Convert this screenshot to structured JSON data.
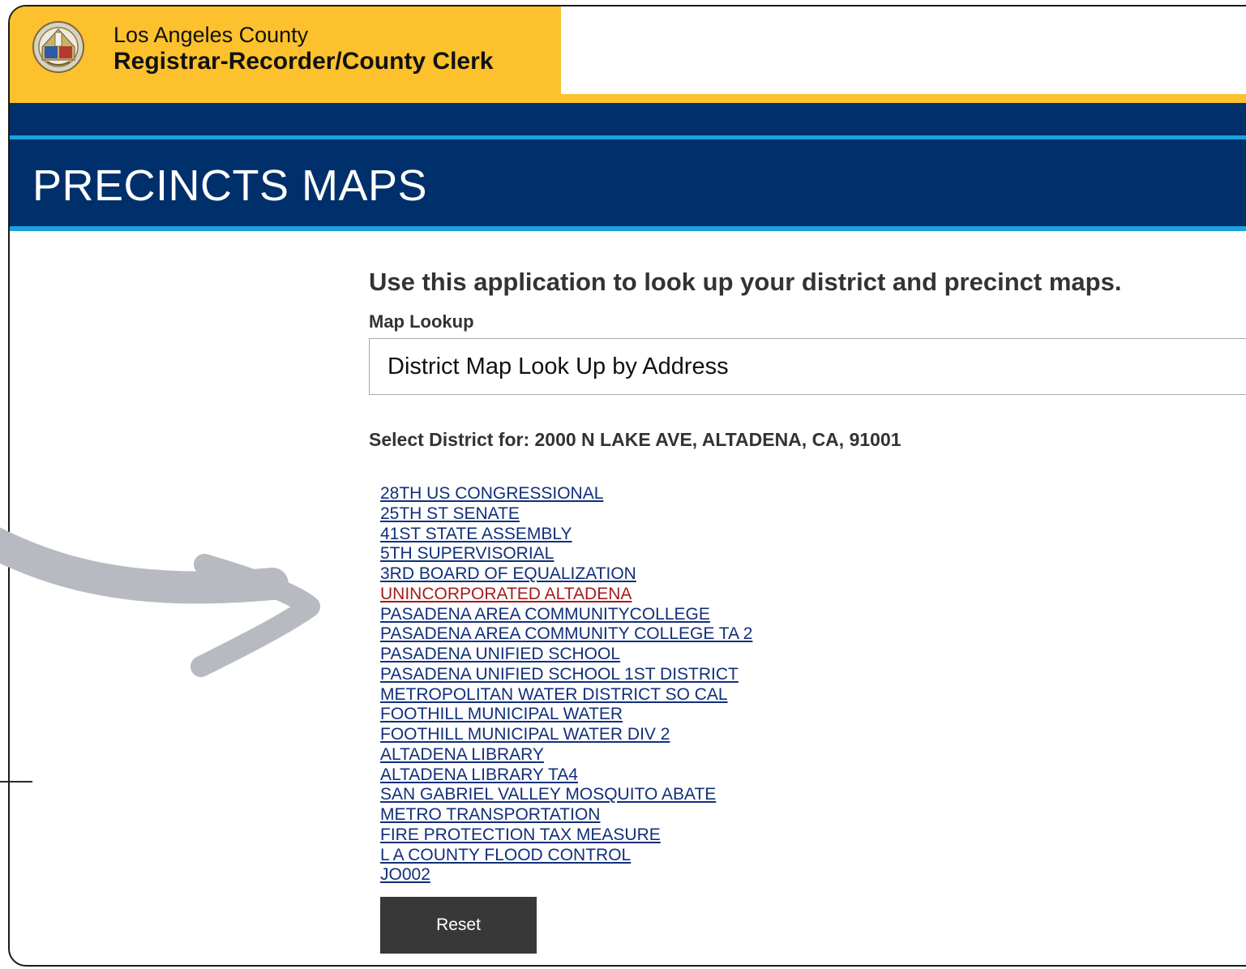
{
  "header": {
    "agency_line1": "Los Angeles County",
    "agency_line2": "Registrar-Recorder/County Clerk",
    "seal_icon": "county-seal-icon"
  },
  "page": {
    "title": "PRECINCTS MAPS"
  },
  "content": {
    "intro": "Use this application to look up your district and precinct maps.",
    "lookup_label": "Map Lookup",
    "lookup_value": "District Map Look Up by Address",
    "select_for": "Select District for: 2000 N LAKE AVE, ALTADENA, CA, 91001"
  },
  "districts": [
    {
      "label": "28TH US CONGRESSIONAL",
      "active": false
    },
    {
      "label": "25TH ST SENATE",
      "active": false
    },
    {
      "label": "41ST STATE ASSEMBLY",
      "active": false
    },
    {
      "label": "5TH SUPERVISORIAL",
      "active": false
    },
    {
      "label": "3RD BOARD OF EQUALIZATION",
      "active": false
    },
    {
      "label": "UNINCORPORATED ALTADENA",
      "active": true
    },
    {
      "label": "PASADENA AREA COMMUNITYCOLLEGE",
      "active": false
    },
    {
      "label": "PASADENA AREA COMMUNITY COLLEGE TA 2",
      "active": false
    },
    {
      "label": "PASADENA UNIFIED SCHOOL",
      "active": false
    },
    {
      "label": "PASADENA UNIFIED SCHOOL 1ST DISTRICT",
      "active": false
    },
    {
      "label": "METROPOLITAN WATER DISTRICT SO CAL",
      "active": false
    },
    {
      "label": "FOOTHILL MUNICIPAL WATER",
      "active": false
    },
    {
      "label": "FOOTHILL MUNICIPAL WATER DIV 2",
      "active": false
    },
    {
      "label": "ALTADENA LIBRARY",
      "active": false
    },
    {
      "label": "ALTADENA LIBRARY TA4",
      "active": false
    },
    {
      "label": "SAN GABRIEL VALLEY MOSQUITO ABATE",
      "active": false
    },
    {
      "label": "METRO TRANSPORTATION",
      "active": false
    },
    {
      "label": "FIRE PROTECTION TAX MEASURE",
      "active": false
    },
    {
      "label": "L A COUNTY FLOOD CONTROL",
      "active": false
    },
    {
      "label": "JO002",
      "active": false
    }
  ],
  "actions": {
    "reset_label": "Reset"
  },
  "colors": {
    "brand_yellow": "#fcc12c",
    "navy": "#00306b",
    "accent_blue": "#1aa3df",
    "link_blue": "#112f7a",
    "link_active_red": "#a31d1d",
    "button_dark": "#383838",
    "arrow_gray": "#b7bac0"
  }
}
